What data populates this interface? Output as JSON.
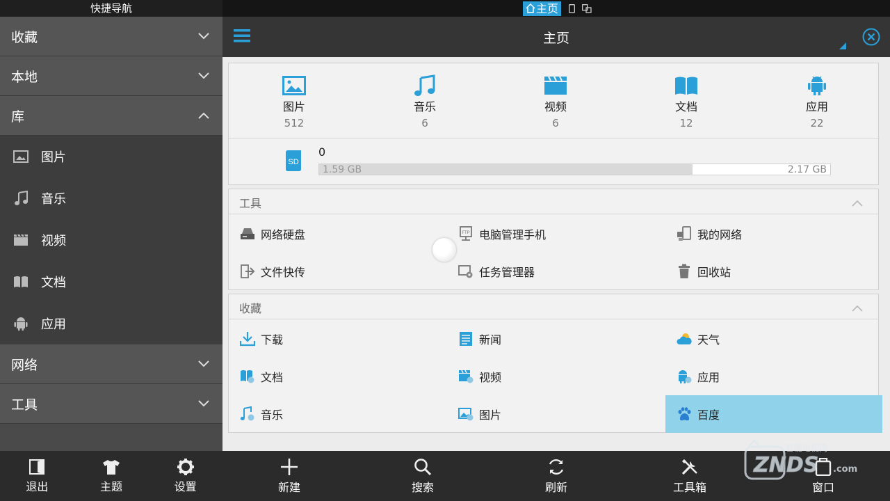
{
  "colors": {
    "accent": "#2a9fd8",
    "highlight": "#8fd2ea",
    "sidebar": "#4a4a4a",
    "toolbar": "#2b2b2b"
  },
  "sidebar": {
    "title": "快捷导航",
    "sections": [
      {
        "label": "收藏",
        "expanded": false
      },
      {
        "label": "本地",
        "expanded": false
      },
      {
        "label": "库",
        "expanded": true
      },
      {
        "label": "网络",
        "expanded": false
      },
      {
        "label": "工具",
        "expanded": false
      }
    ],
    "library_items": [
      {
        "label": "图片",
        "icon": "image-icon"
      },
      {
        "label": "音乐",
        "icon": "music-icon"
      },
      {
        "label": "视频",
        "icon": "video-icon"
      },
      {
        "label": "文档",
        "icon": "book-icon"
      },
      {
        "label": "应用",
        "icon": "android-icon"
      }
    ],
    "footer": [
      {
        "label": "退出",
        "icon": "exit-icon"
      },
      {
        "label": "主题",
        "icon": "shirt-icon"
      },
      {
        "label": "设置",
        "icon": "gear-icon"
      }
    ]
  },
  "status_bar": {
    "home_label": "主页"
  },
  "header": {
    "title": "主页"
  },
  "library": {
    "items": [
      {
        "label": "图片",
        "count": "512",
        "icon": "image-icon"
      },
      {
        "label": "音乐",
        "count": "6",
        "icon": "music-icon"
      },
      {
        "label": "视频",
        "count": "6",
        "icon": "video-icon"
      },
      {
        "label": "文档",
        "count": "12",
        "icon": "book-icon"
      },
      {
        "label": "应用",
        "count": "22",
        "icon": "android-icon"
      }
    ],
    "storage": {
      "name": "0",
      "icon_text": "SD",
      "used": "1.59 GB",
      "total": "2.17 GB",
      "used_fraction": 0.73
    }
  },
  "tools": {
    "title": "工具",
    "items": [
      {
        "label": "网络硬盘",
        "icon": "cloud-drive-icon"
      },
      {
        "label": "电脑管理手机",
        "icon": "ftp-icon"
      },
      {
        "label": "我的网络",
        "icon": "network-icon"
      },
      {
        "label": "文件快传",
        "icon": "file-transfer-icon"
      },
      {
        "label": "任务管理器",
        "icon": "task-manager-icon"
      },
      {
        "label": "回收站",
        "icon": "trash-icon"
      }
    ]
  },
  "favorites": {
    "title": "收藏",
    "items": [
      {
        "label": "下载",
        "icon": "download-icon"
      },
      {
        "label": "新闻",
        "icon": "news-icon"
      },
      {
        "label": "天气",
        "icon": "weather-icon"
      },
      {
        "label": "文档",
        "icon": "book-web-icon"
      },
      {
        "label": "视频",
        "icon": "video-web-icon"
      },
      {
        "label": "应用",
        "icon": "android-web-icon"
      },
      {
        "label": "音乐",
        "icon": "music-web-icon"
      },
      {
        "label": "图片",
        "icon": "image-web-icon"
      },
      {
        "label": "百度",
        "icon": "baidu-paw-icon",
        "selected": true
      }
    ]
  },
  "bottom_bar": [
    {
      "label": "新建",
      "icon": "plus-icon"
    },
    {
      "label": "搜索",
      "icon": "search-icon"
    },
    {
      "label": "刷新",
      "icon": "refresh-icon"
    },
    {
      "label": "工具箱",
      "icon": "tools-icon"
    },
    {
      "label": "窗口",
      "icon": "window-icon"
    }
  ],
  "watermark": {
    "text": "ZNDS",
    "suffix": ".com",
    "tagline": "智能电视网"
  }
}
